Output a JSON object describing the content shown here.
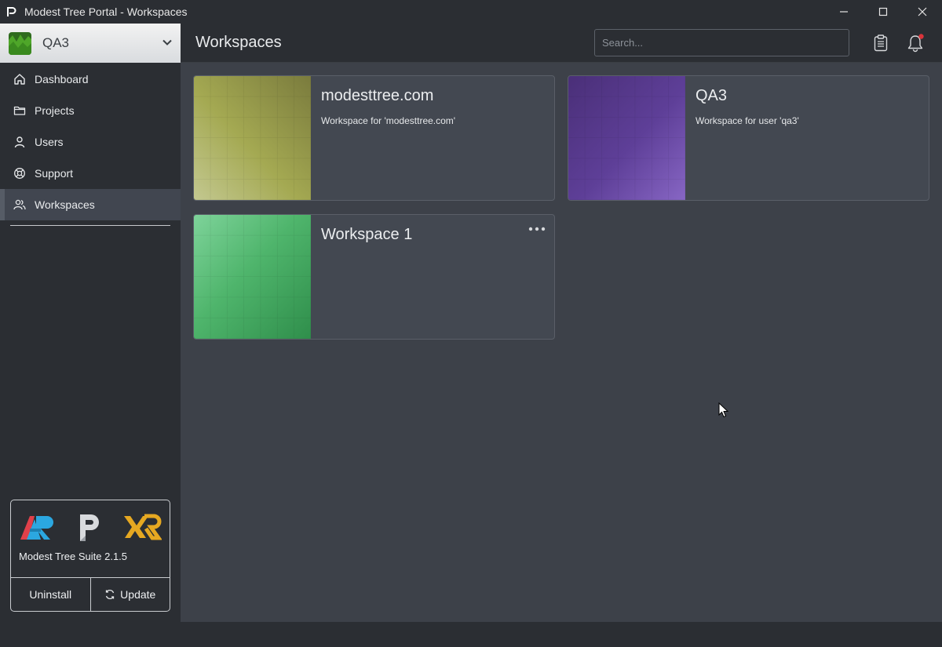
{
  "window": {
    "title": "Modest Tree Portal - Workspaces",
    "controls": [
      "minimize-icon",
      "maximize-icon",
      "close-icon"
    ]
  },
  "sidebar": {
    "workspace_selector": {
      "name": "QA3"
    },
    "items": [
      {
        "label": "Dashboard",
        "icon": "home-icon",
        "active": false
      },
      {
        "label": "Projects",
        "icon": "folder-icon",
        "active": false
      },
      {
        "label": "Users",
        "icon": "user-icon",
        "active": false
      },
      {
        "label": "Support",
        "icon": "lifebuoy-icon",
        "active": false
      },
      {
        "label": "Workspaces",
        "icon": "users-icon",
        "active": true
      }
    ],
    "suite": {
      "name": "Modest Tree Suite 2.1.5",
      "uninstall_label": "Uninstall",
      "update_label": "Update"
    }
  },
  "header": {
    "title": "Workspaces",
    "search_placeholder": "Search..."
  },
  "workspaces": [
    {
      "name": "modesttree.com",
      "description": "Workspace for 'modesttree.com'"
    },
    {
      "name": "QA3",
      "description": "Workspace for user 'qa3'"
    },
    {
      "name": "Workspace 1",
      "description": ""
    }
  ],
  "colors": {
    "notification_dot": "#d9343b",
    "card_olive": "#8e9448",
    "card_purple": "#6a4ba4",
    "card_green": "#4bb06a"
  }
}
